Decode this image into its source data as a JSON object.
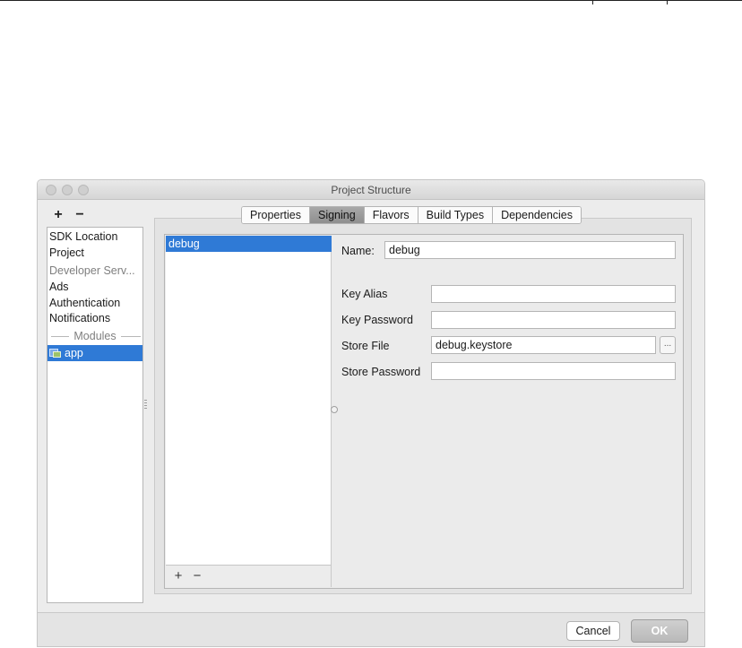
{
  "window": {
    "title": "Project Structure"
  },
  "left_panel": {
    "add_label": "+",
    "remove_label": "−",
    "items": [
      {
        "label": "SDK Location"
      },
      {
        "label": "Project"
      },
      {
        "label": "Developer Serv..."
      },
      {
        "label": "Ads"
      },
      {
        "label": "Authentication"
      },
      {
        "label": "Notifications"
      }
    ],
    "section_label": "Modules",
    "modules": [
      {
        "label": "app",
        "selected": true
      }
    ]
  },
  "tabs": [
    {
      "label": "Properties"
    },
    {
      "label": "Signing",
      "active": true
    },
    {
      "label": "Flavors"
    },
    {
      "label": "Build Types"
    },
    {
      "label": "Dependencies"
    }
  ],
  "signing": {
    "configs": [
      {
        "label": "debug",
        "selected": true
      }
    ],
    "add_label": "+",
    "remove_label": "−",
    "form": {
      "name_label": "Name:",
      "name_value": "debug",
      "key_alias_label": "Key Alias",
      "key_alias_value": "",
      "key_password_label": "Key Password",
      "key_password_value": "",
      "store_file_label": "Store File",
      "store_file_value": "debug.keystore",
      "browse_label": "...",
      "store_password_label": "Store Password",
      "store_password_value": ""
    }
  },
  "buttons": {
    "cancel": "Cancel",
    "ok": "OK"
  },
  "colors": {
    "selection": "#2f7ad6",
    "window_bg": "#ececec"
  }
}
